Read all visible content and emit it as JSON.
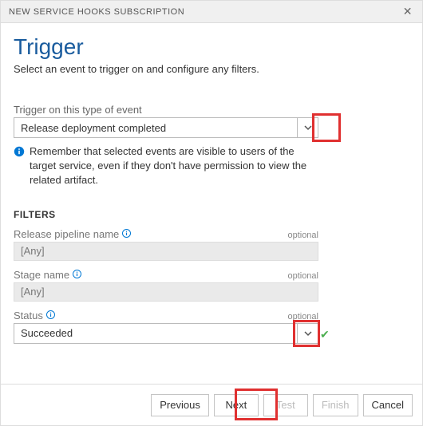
{
  "titlebar": {
    "title": "NEW SERVICE HOOKS SUBSCRIPTION"
  },
  "header": {
    "heading": "Trigger",
    "subtitle": "Select an event to trigger on and configure any filters."
  },
  "event": {
    "label": "Trigger on this type of event",
    "value": "Release deployment completed",
    "info": "Remember that selected events are visible to users of the target service, even if they don't have permission to view the related artifact."
  },
  "filters": {
    "heading": "FILTERS",
    "pipeline": {
      "label": "Release pipeline name",
      "optional": "optional",
      "value": "[Any]"
    },
    "stage": {
      "label": "Stage name",
      "optional": "optional",
      "value": "[Any]"
    },
    "status": {
      "label": "Status",
      "optional": "optional",
      "value": "Succeeded"
    }
  },
  "footer": {
    "previous": "Previous",
    "next": "Next",
    "test": "Test",
    "finish": "Finish",
    "cancel": "Cancel"
  }
}
